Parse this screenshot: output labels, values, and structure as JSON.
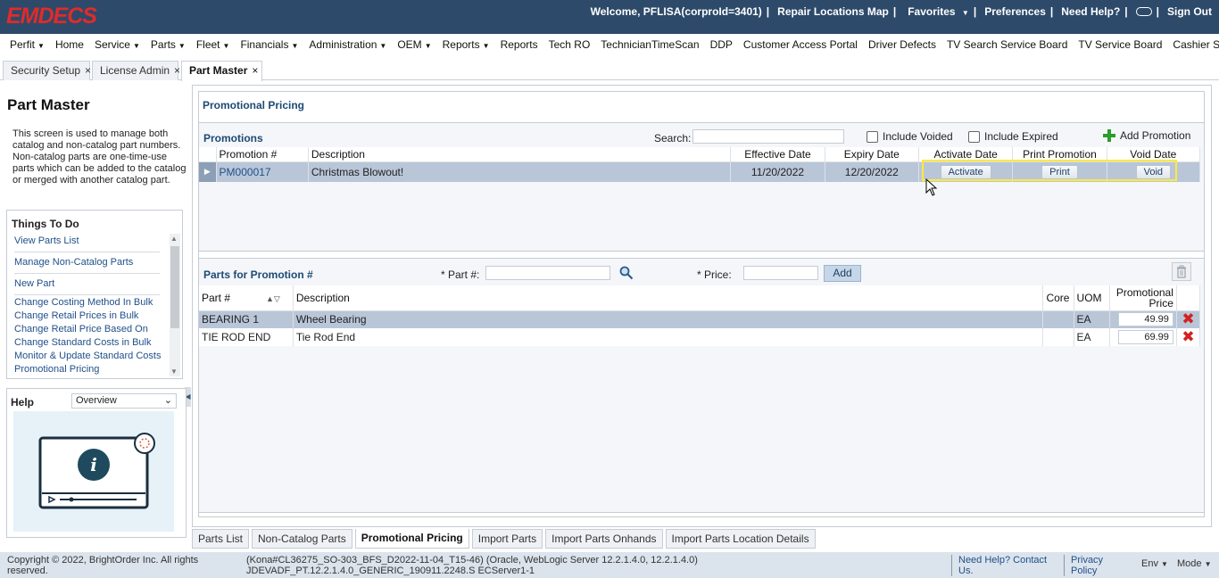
{
  "header": {
    "logo": "EMDECS",
    "welcome": "Welcome, PFLISA(corproId=3401)",
    "repair_map": "Repair Locations Map",
    "favorites": "Favorites",
    "preferences": "Preferences",
    "need_help": "Need Help?",
    "sign_out": "Sign Out",
    "header_bg": "#2d4a6a",
    "logo_color": "#e02b2b"
  },
  "menu": [
    {
      "label": "Perfit",
      "dd": true
    },
    {
      "label": "Home",
      "dd": false
    },
    {
      "label": "Service",
      "dd": true
    },
    {
      "label": "Parts",
      "dd": true
    },
    {
      "label": "Fleet",
      "dd": true
    },
    {
      "label": "Financials",
      "dd": true
    },
    {
      "label": "Administration",
      "dd": true
    },
    {
      "label": "OEM",
      "dd": true
    },
    {
      "label": "Reports",
      "dd": true
    },
    {
      "label": "Reports",
      "dd": false
    },
    {
      "label": "Tech RO",
      "dd": false
    },
    {
      "label": "TechnicianTimeScan",
      "dd": false
    },
    {
      "label": "DDP",
      "dd": false
    },
    {
      "label": "Customer Access Portal",
      "dd": false
    },
    {
      "label": "Driver Defects",
      "dd": false
    },
    {
      "label": "TV Search Service Board",
      "dd": false
    },
    {
      "label": "TV Service Board",
      "dd": false
    },
    {
      "label": "Cashier Shift",
      "dd": false
    }
  ],
  "window_tabs": [
    {
      "label": "Security Setup",
      "active": false
    },
    {
      "label": "License Admin",
      "active": false
    },
    {
      "label": "Part Master",
      "active": true
    }
  ],
  "left": {
    "title": "Part Master",
    "description": "This screen is used to manage both catalog and non-catalog part numbers. Non-catalog parts are one-time-use parts which can be added to the catalog or merged with another catalog part.",
    "things_title": "Things To Do",
    "things": [
      "View Parts List",
      "Manage Non-Catalog Parts",
      "New Part",
      "Change Costing Method In Bulk",
      "Change Retail Prices in Bulk",
      "Change Retail Price Based On",
      "Change Standard Costs in Bulk",
      "Monitor & Update Standard Costs",
      "Promotional Pricing"
    ],
    "help_title": "Help",
    "help_selected": "Overview"
  },
  "main": {
    "title": "Promotional Pricing",
    "promotions": {
      "title": "Promotions",
      "search_label": "Search:",
      "search_value": "",
      "include_voided": "Include Voided",
      "include_expired": "Include Expired",
      "add_promotion": "Add Promotion",
      "columns": [
        "Promotion #",
        "Description",
        "Effective Date",
        "Expiry Date",
        "Activate Date",
        "Print Promotion",
        "Void Date"
      ],
      "rows": [
        {
          "promo": "PM000017",
          "desc": "Christmas Blowout!",
          "effective": "11/20/2022",
          "expiry": "12/20/2022",
          "activate": "Activate",
          "print": "Print",
          "void": "Void"
        }
      ]
    },
    "parts": {
      "title": "Parts for Promotion #",
      "part_label": "* Part #:",
      "price_label": "* Price:",
      "add": "Add",
      "columns": [
        "Part #",
        "Description",
        "Core",
        "UOM",
        "Promotional Price"
      ],
      "rows": [
        {
          "part": "BEARING 1",
          "desc": "Wheel Bearing",
          "core": "",
          "uom": "EA",
          "price": "49.99"
        },
        {
          "part": "TIE ROD END",
          "desc": "Tie Rod End",
          "core": "",
          "uom": "EA",
          "price": "69.99"
        }
      ]
    }
  },
  "bottom_tabs": [
    {
      "label": "Parts List",
      "active": false
    },
    {
      "label": "Non-Catalog Parts",
      "active": false
    },
    {
      "label": "Promotional Pricing",
      "active": true
    },
    {
      "label": "Import Parts",
      "active": false
    },
    {
      "label": "Import Parts Onhands",
      "active": false
    },
    {
      "label": "Import Parts Location Details",
      "active": false
    }
  ],
  "footer": {
    "copyright": "Copyright © 2022, BrightOrder Inc. All rights reserved.",
    "build": "(Kona#CL36275_SO-303_BFS_D2022-11-04_T15-46) (Oracle, WebLogic Server 12.2.1.4.0, 12.2.1.4.0) JDEVADF_PT.12.2.1.4.0_GENERIC_190911.2248.S ECServer1-1",
    "help_contact": "Need Help? Contact Us.",
    "privacy": "Privacy Policy",
    "env": "Env",
    "mode": "Mode"
  }
}
